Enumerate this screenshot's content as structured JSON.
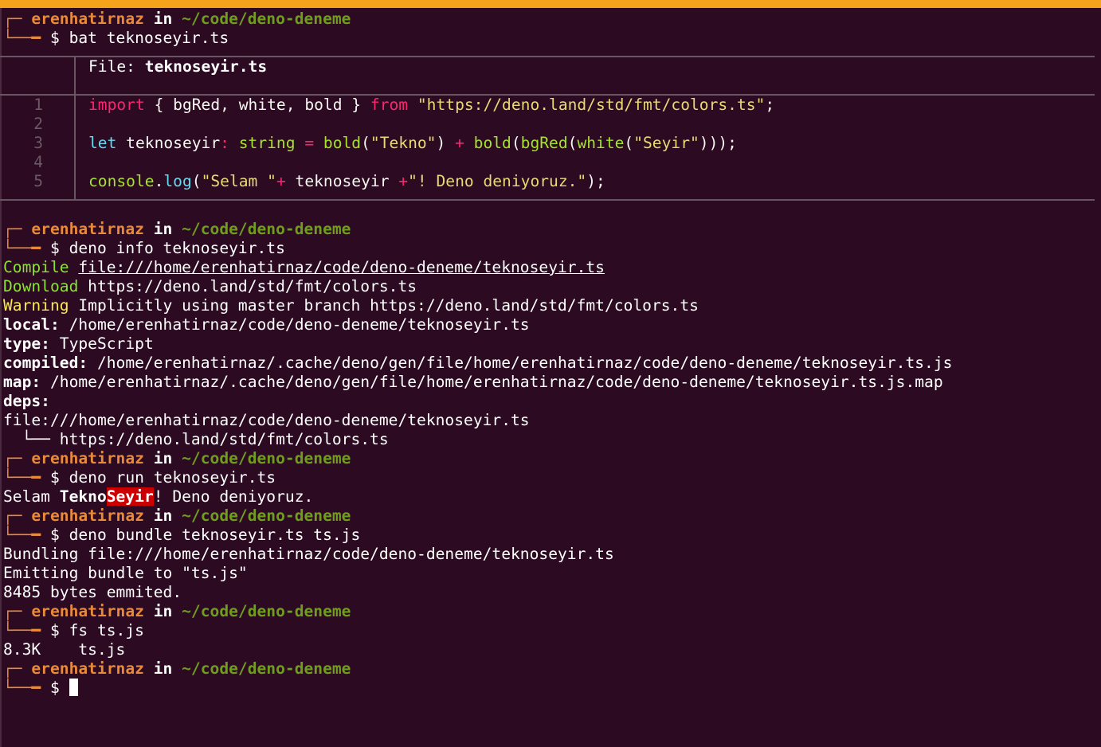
{
  "prompt": {
    "corner_top": "┌─",
    "corner_bottom": "└──━",
    "user": "erenhatirnaz",
    "in": "in",
    "path": "~/code/deno-deneme",
    "dollar": "$"
  },
  "blocks": [
    {
      "command": "bat teknoseyir.ts"
    },
    {
      "command": "deno info teknoseyir.ts"
    },
    {
      "command": "deno run teknoseyir.ts"
    },
    {
      "command": "deno bundle teknoseyir.ts ts.js"
    },
    {
      "command": "fs ts.js"
    },
    {
      "command": ""
    }
  ],
  "bat": {
    "file_label": "File: ",
    "file_name": "teknoseyir.ts",
    "line_numbers": [
      "1",
      "2",
      "3",
      "4",
      "5"
    ],
    "code": {
      "l1_import": "import",
      "l1_names": " { bgRed, white, bold } ",
      "l1_from": "from",
      "l1_space": " ",
      "l1_url": "\"https://deno.land/std/fmt/colors.ts\"",
      "l1_semi": ";",
      "l3_let": "let",
      "l3_var": " teknoseyir",
      "l3_colon": ":",
      "l3_type": " string",
      "l3_eq": " = ",
      "l3_bold1": "bold",
      "l3_p1": "(",
      "l3_s1": "\"Tekno\"",
      "l3_p2": ") ",
      "l3_plus": "+",
      "l3_sp": " ",
      "l3_bold2": "bold",
      "l3_p3": "(",
      "l3_bgred": "bgRed",
      "l3_p4": "(",
      "l3_white": "white",
      "l3_p5": "(",
      "l3_s2": "\"Seyir\"",
      "l3_end": ")));",
      "l5_console": "console",
      "l5_dot": ".",
      "l5_log": "log",
      "l5_p1": "(",
      "l5_s1": "\"Selam \"",
      "l5_plus1": "+",
      "l5_var": " teknoseyir ",
      "l5_plus2": "+",
      "l5_s2": "\"! Deno deniyoruz.\"",
      "l5_end": ");"
    }
  },
  "info": {
    "compile_label": "Compile",
    "compile_value": "file:///home/erenhatirnaz/code/deno-deneme/teknoseyir.ts",
    "download_label": "Download",
    "download_value": " https://deno.land/std/fmt/colors.ts",
    "warning_label": "Warning",
    "warning_value": " Implicitly using master branch https://deno.land/std/fmt/colors.ts",
    "local_label": "local:",
    "local_value": " /home/erenhatirnaz/code/deno-deneme/teknoseyir.ts",
    "type_label": "type:",
    "type_value": " TypeScript",
    "compiled_label": "compiled:",
    "compiled_value": " /home/erenhatirnaz/.cache/deno/gen/file/home/erenhatirnaz/code/deno-deneme/teknoseyir.ts.js",
    "map_label": "map:",
    "map_value": " /home/erenhatirnaz/.cache/deno/gen/file/home/erenhatirnaz/code/deno-deneme/teknoseyir.ts.js.map",
    "deps_label": "deps:",
    "dep_root": "file:///home/erenhatirnaz/code/deno-deneme/teknoseyir.ts",
    "dep_child": "  └── https://deno.land/std/fmt/colors.ts"
  },
  "run_output": {
    "prefix": "Selam ",
    "tekno": "Tekno",
    "seyir": "Seyir",
    "suffix": "! Deno deniyoruz."
  },
  "bundle_output": [
    "Bundling file:///home/erenhatirnaz/code/deno-deneme/teknoseyir.ts",
    "Emitting bundle to \"ts.js\"",
    "8485 bytes emmited."
  ],
  "fs_output": "8.3K    ts.js",
  "colors": {
    "accent_bar": "#f4a31b",
    "background": "#2c0a21",
    "user": "#e9893a",
    "path": "#6f9d1e"
  }
}
